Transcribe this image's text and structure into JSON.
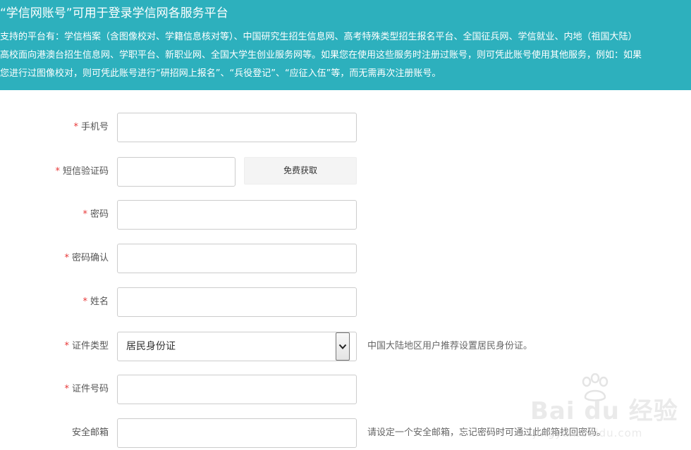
{
  "banner": {
    "title": "“学信网账号”可用于登录学信网各服务平台",
    "lines": [
      "支持的平台有：学信档案（含图像校对、学籍信息核对等）、中国研究生招生信息网、高考特殊类型招生报名平台、全国征兵网、学信就业、内地（祖国大陆）",
      "高校面向港澳台招生信息网、学职平台、新职业网、全国大学生创业服务网等。如果您在使用这些服务时注册过账号，则可凭此账号使用其他服务，例如：如果",
      "您进行过图像校对，则可凭此账号进行“研招网上报名”、“兵役登记”、“应征入伍”等，而无需再次注册账号。"
    ]
  },
  "form": {
    "required_mark": "*",
    "phone_label": "手机号",
    "sms_label": "短信验证码",
    "sms_button": "免费获取",
    "password_label": "密码",
    "password_confirm_label": "密码确认",
    "name_label": "姓名",
    "id_type_label": "证件类型",
    "id_type_value": "居民身份证",
    "id_type_hint": "中国大陆地区用户推荐设置居民身份证。",
    "id_number_label": "证件号码",
    "email_label": "安全邮箱",
    "email_hint": "请设定一个安全邮箱，忘记密码时可通过此邮箱找回密码。"
  },
  "watermark": {
    "main": "Bai du 经验",
    "sub": "jingyan.baidu.com"
  }
}
